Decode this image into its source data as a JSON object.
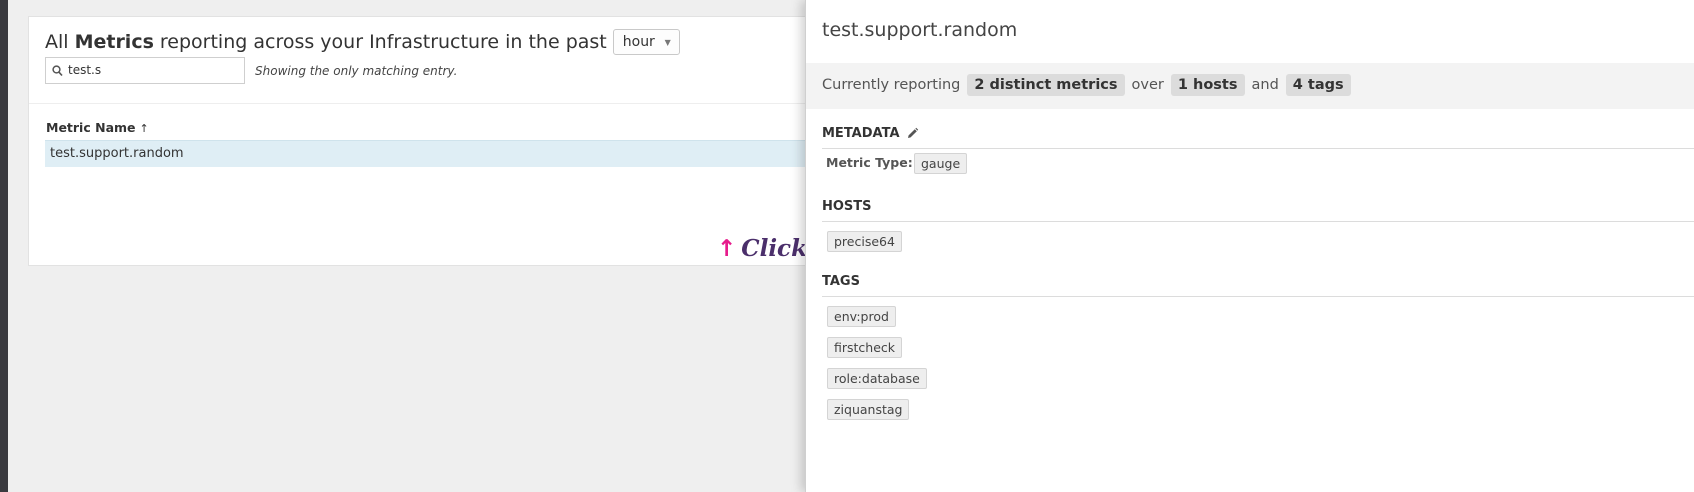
{
  "header": {
    "prefix": "All",
    "metrics_word": "Metrics",
    "suffix": "reporting across your Infrastructure in the past",
    "time_range": "hour"
  },
  "search": {
    "value": "test.s",
    "note": "Showing the only matching entry."
  },
  "table": {
    "column_header": "Metric Name",
    "sort_indicator": "↑",
    "rows": [
      {
        "name": "test.support.random"
      }
    ]
  },
  "hint": {
    "arrow": "↑",
    "text": "Click a"
  },
  "detail": {
    "title": "test.support.random",
    "summary": {
      "prefix": "Currently reporting",
      "metrics": "2 distinct metrics",
      "over": "over",
      "hosts": "1 hosts",
      "and": "and",
      "tags": "4 tags"
    },
    "metadata": {
      "heading": "METADATA",
      "type_label": "Metric Type:",
      "type_value": "gauge"
    },
    "hosts": {
      "heading": "HOSTS",
      "items": [
        "precise64"
      ]
    },
    "tags": {
      "heading": "TAGS",
      "items": [
        "env:prod",
        "firstcheck",
        "role:database",
        "ziquanstag"
      ]
    }
  },
  "colors": {
    "selected_row": "#dfeef5",
    "hint_arrow": "#e61c8c",
    "hint_text": "#4b2f6b",
    "sidebar": "#3a3a3f"
  },
  "icons": {
    "search": "search-icon",
    "edit": "pencil-icon",
    "dropdown": "caret-down-icon"
  }
}
